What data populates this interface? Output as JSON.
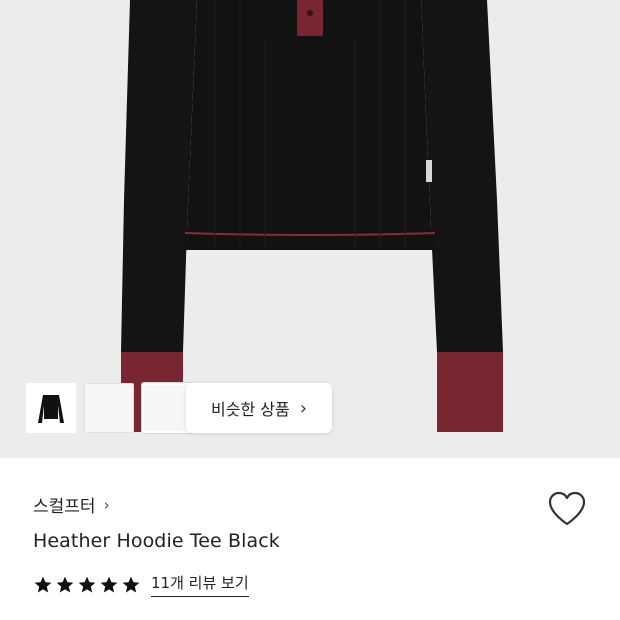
{
  "product": {
    "brand": "스컬프터",
    "name": "Heather Hoodie Tee Black",
    "rating": 5,
    "max_rating": 5,
    "review_link_label": "11개 리뷰 보기"
  },
  "gallery": {
    "similar_button_label": "비슷한 상품",
    "thumbnails": [
      {
        "name": "thumbnail-gray",
        "color": "#4a4a4a"
      },
      {
        "name": "thumbnail-brown",
        "color": "#5b3a22"
      },
      {
        "name": "thumbnail-black",
        "color": "#111111"
      }
    ]
  },
  "icons": {
    "brand_chevron": "chevron-right-icon",
    "similar_chevron": "chevron-right-icon",
    "wishlist": "heart-outline-icon",
    "star": "star-filled-icon"
  },
  "colors": {
    "garment": "#141414",
    "cuff": "#7a2630",
    "stitch": "#8c2a35",
    "hero_bg": "#ececec"
  }
}
